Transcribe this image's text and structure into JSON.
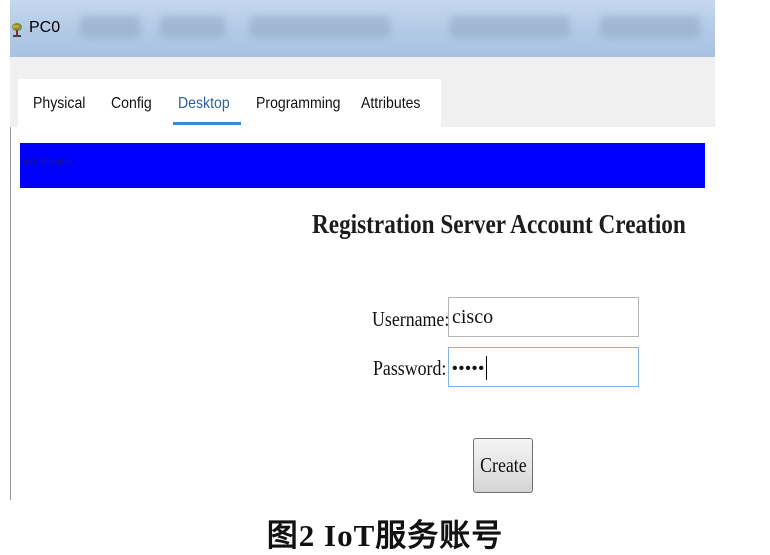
{
  "window": {
    "title": "PC0",
    "icon": "device-icon"
  },
  "tabs": [
    {
      "label": "Physical",
      "active": false
    },
    {
      "label": "Config",
      "active": false
    },
    {
      "label": "Desktop",
      "active": true
    },
    {
      "label": "Programming",
      "active": false
    },
    {
      "label": "Attributes",
      "active": false
    }
  ],
  "app_bar": {
    "label": "IoT Monitor",
    "color": "#0000ff"
  },
  "form": {
    "heading": "Registration Server Account Creation",
    "username_label": "Username:",
    "username_value": "cisco",
    "password_label": "Password:",
    "password_value": "•••••",
    "create_label": "Create"
  },
  "caption": "图2   IoT服务账号"
}
